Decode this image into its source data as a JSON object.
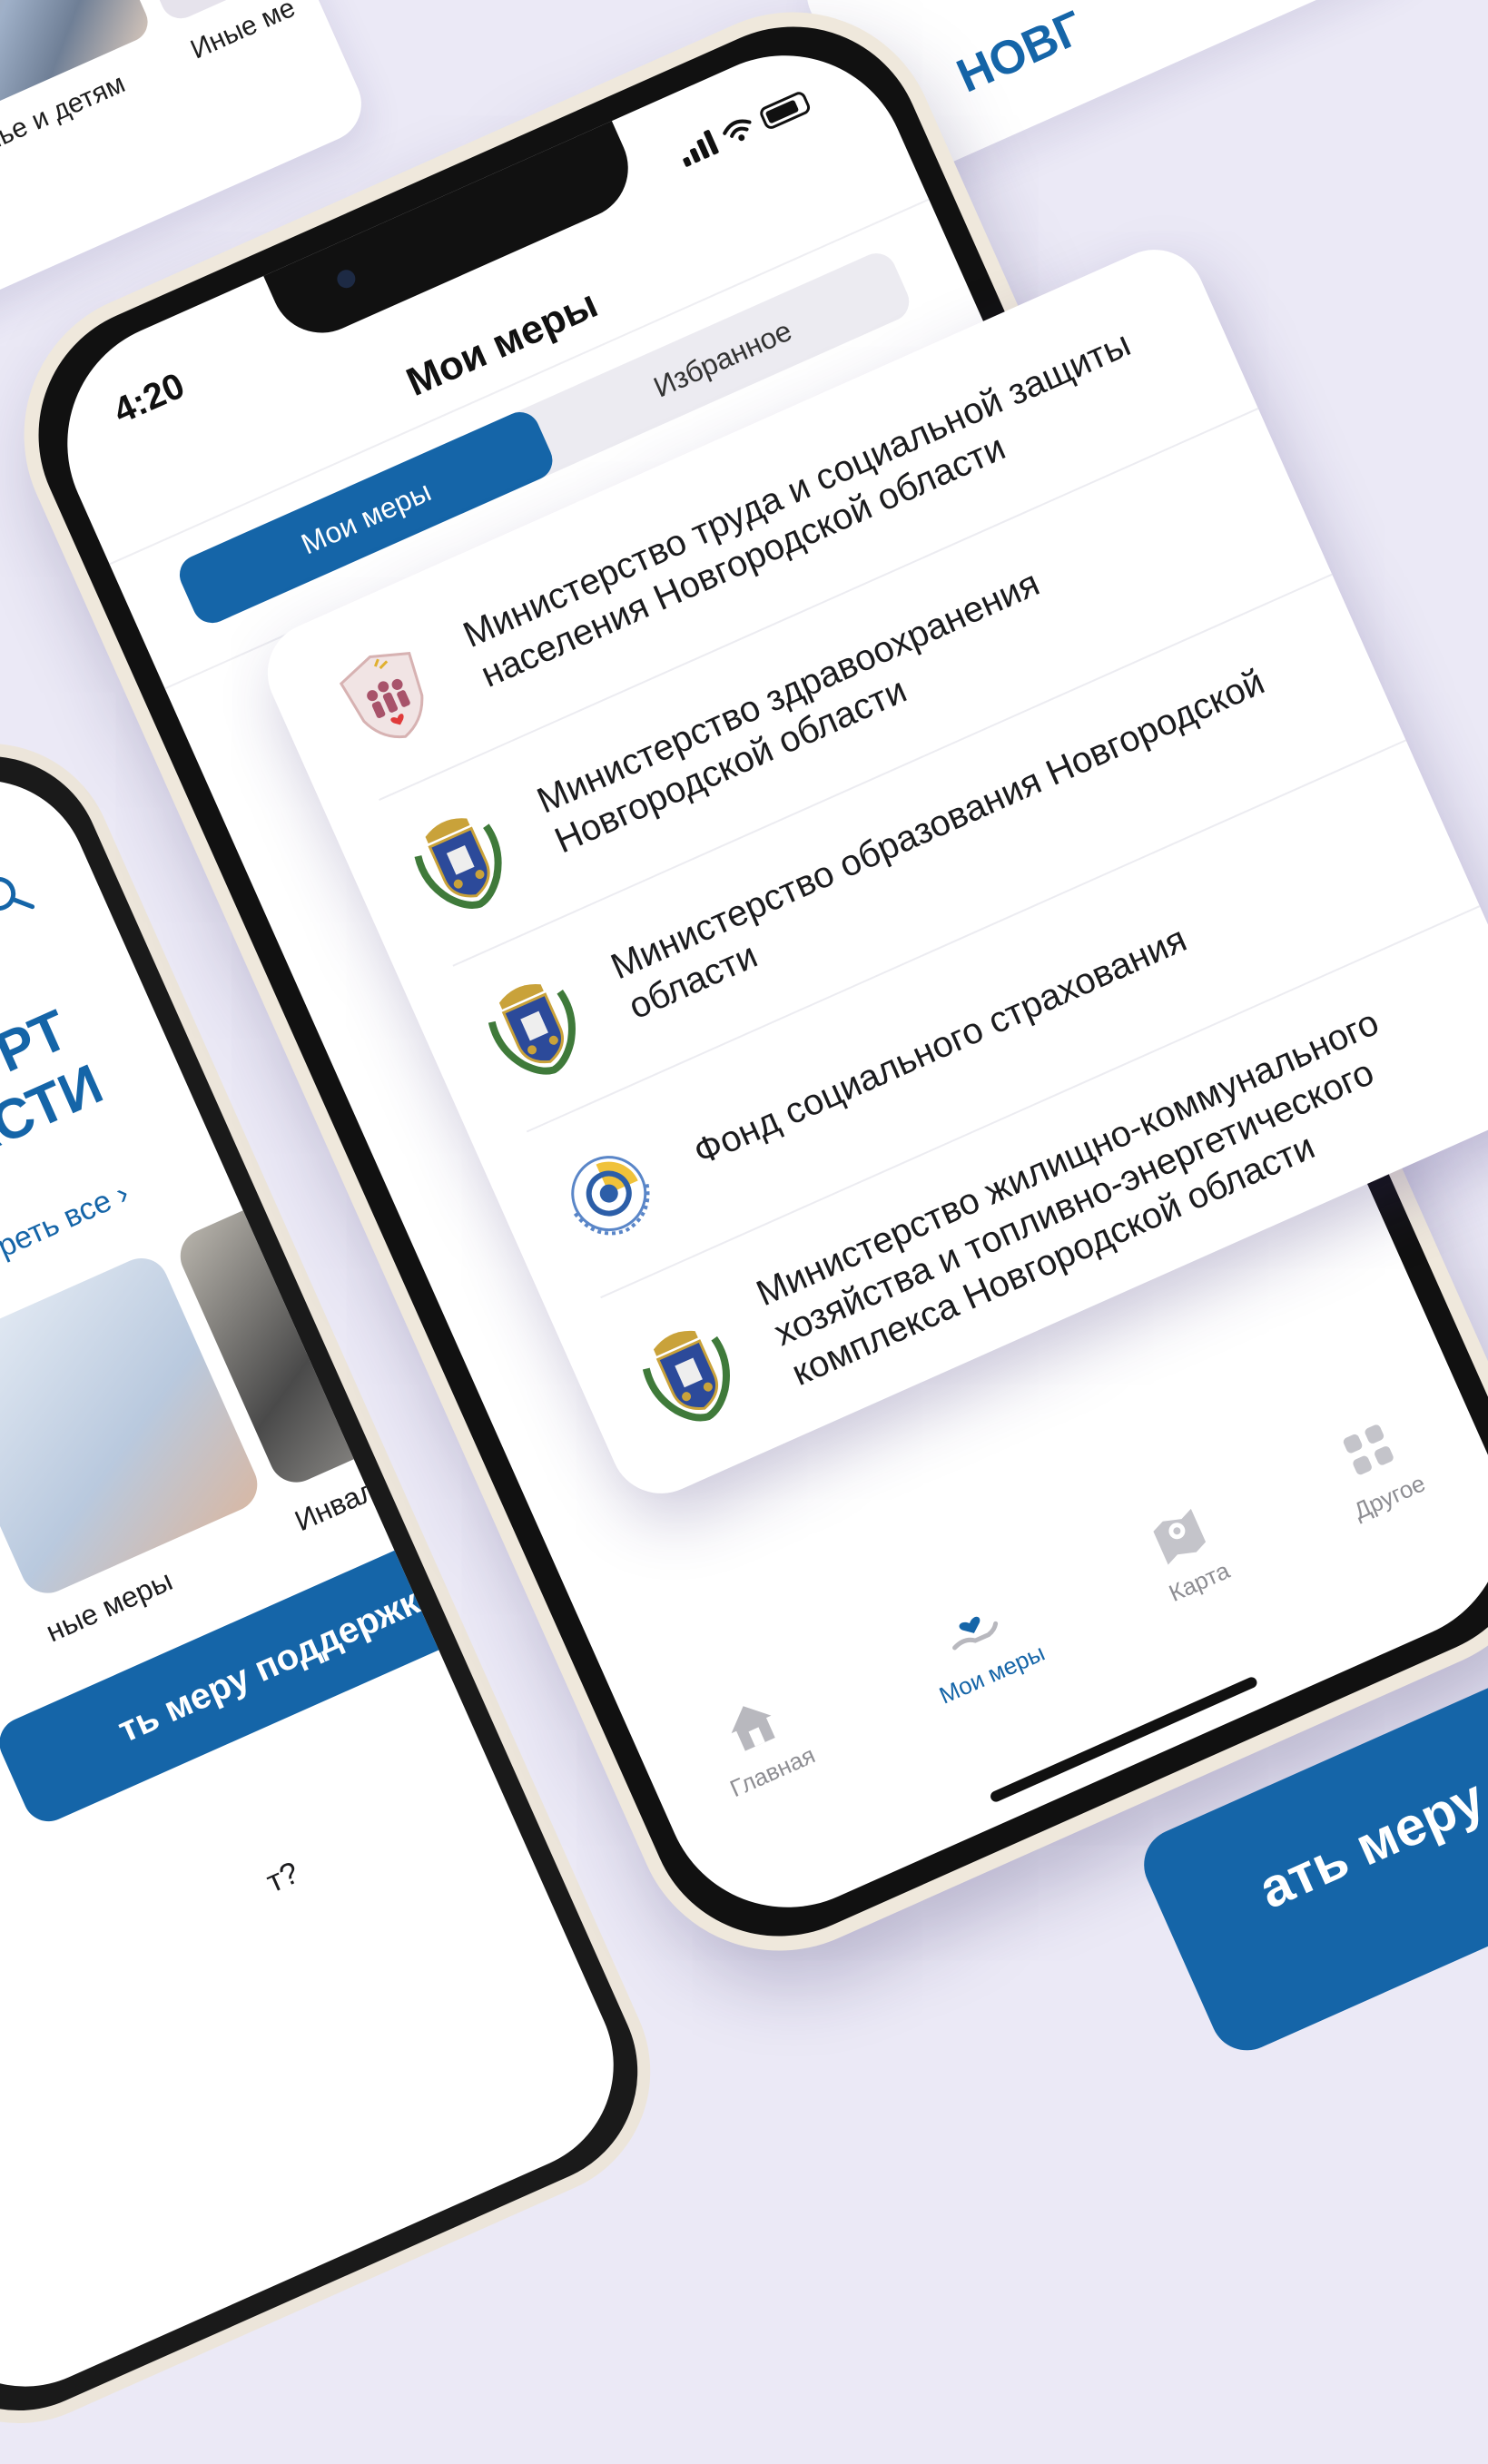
{
  "bg_card_top_left": {
    "label_family": "емье и детям",
    "label_other": "Иные ме"
  },
  "bg_card_top_right": {
    "label": "НОВГ"
  },
  "left_phone": {
    "heading_line1": "РТ",
    "heading_line2": "АСТИ",
    "view_all": "отреть все",
    "item_other": "ные меры",
    "item_disabled": "Инвалид",
    "cta": "ть меру поддержки",
    "question": "т?"
  },
  "main_phone": {
    "status_time": "4:20",
    "title": "Мои меры",
    "segment": {
      "active": "Мои меры",
      "inactive": "Избранное"
    },
    "tabs": [
      {
        "label": "Главная",
        "icon": "home-icon",
        "active": false
      },
      {
        "label": "Мои меры",
        "icon": "heart-hand-icon",
        "active": true
      },
      {
        "label": "Карта",
        "icon": "map-icon",
        "active": false
      },
      {
        "label": "Другое",
        "icon": "grid-icon",
        "active": false
      }
    ]
  },
  "list_card": {
    "items": [
      {
        "name": "Министерство труда и социальной защиты населения Новгородской области",
        "logo": "social-protection-shield-logo"
      },
      {
        "name": "Министерство здравоохранения Новгородской области",
        "logo": "novgorod-coat-of-arms-logo"
      },
      {
        "name": "Министерство образования Новгородской области",
        "logo": "novgorod-coat-of-arms-logo"
      },
      {
        "name": "Фонд социального страхования",
        "logo": "social-insurance-fund-logo"
      },
      {
        "name": "Министерство жилищно-коммунального хозяйства и топливно-энергетического комплекса Новгородской области",
        "logo": "novgorod-coat-of-arms-logo"
      }
    ]
  },
  "bottom_right_cta": {
    "label": "ать меру"
  },
  "colors": {
    "background": "#ebe9f6",
    "accent": "#1565a8",
    "text": "#1c1c1e",
    "muted": "#8e8e93"
  }
}
